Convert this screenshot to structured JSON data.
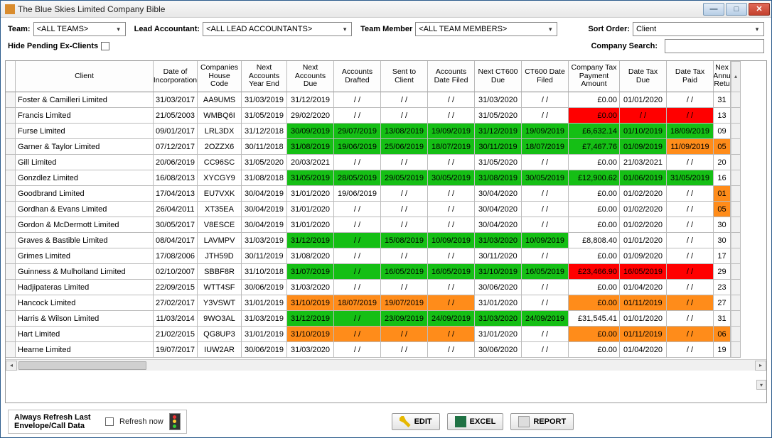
{
  "window": {
    "title": "The Blue Skies Limited Company Bible"
  },
  "filters": {
    "team_label": "Team:",
    "team_value": "<ALL TEAMS>",
    "lead_label": "Lead Accountant:",
    "lead_value": "<ALL LEAD ACCOUNTANTS>",
    "member_label": "Team Member",
    "member_value": "<ALL TEAM MEMBERS>",
    "sort_label": "Sort Order:",
    "sort_value": "Client",
    "hide_label": "Hide Pending Ex-Clients",
    "search_label": "Company Search:",
    "search_value": ""
  },
  "columns": [
    "Client",
    "Date of Incorporation",
    "Companies House Code",
    "Next Accounts Year End",
    "Next Accounts Due",
    "Accounts Drafted",
    "Sent to Client",
    "Accounts Date Filed",
    "Next CT600 Due",
    "CT600 Date Filed",
    "Company Tax Payment Amount",
    "Date Tax Due",
    "Date Tax Paid",
    "Nex Annu Retu"
  ],
  "rows": [
    {
      "c": [
        "Foster & Camilleri Limited",
        "31/03/2017",
        "AA9UMS",
        "31/03/2019",
        "31/12/2019",
        "/ /",
        "/ /",
        "/ /",
        "31/03/2020",
        "/ /",
        "£0.00",
        "01/01/2020",
        "/ /",
        "31"
      ],
      "bg": [
        "",
        "",
        "",
        "",
        "",
        "",
        "",
        "",
        "",
        "",
        "",
        "",
        "",
        ""
      ]
    },
    {
      "c": [
        "Francis Limited",
        "21/05/2003",
        "WMBQ6I",
        "31/05/2019",
        "29/02/2020",
        "/ /",
        "/ /",
        "/ /",
        "31/05/2020",
        "/ /",
        "£0.00",
        "/ /",
        "/ /",
        "13"
      ],
      "bg": [
        "",
        "",
        "",
        "",
        "",
        "",
        "",
        "",
        "",
        "",
        "red",
        "red",
        "red",
        ""
      ]
    },
    {
      "c": [
        "Furse Limited",
        "09/01/2017",
        "LRL3DX",
        "31/12/2018",
        "30/09/2019",
        "29/07/2019",
        "13/08/2019",
        "19/09/2019",
        "31/12/2019",
        "19/09/2019",
        "£6,632.14",
        "01/10/2019",
        "18/09/2019",
        "09"
      ],
      "bg": [
        "",
        "",
        "",
        "",
        "green",
        "green",
        "green",
        "green",
        "green",
        "green",
        "green",
        "green",
        "green",
        ""
      ]
    },
    {
      "c": [
        "Garner & Taylor Limited",
        "07/12/2017",
        "2OZZX6",
        "30/11/2018",
        "31/08/2019",
        "19/06/2019",
        "25/06/2019",
        "18/07/2019",
        "30/11/2019",
        "18/07/2019",
        "£7,467.76",
        "01/09/2019",
        "11/09/2019",
        "05"
      ],
      "bg": [
        "",
        "",
        "",
        "",
        "green",
        "green",
        "green",
        "green",
        "green",
        "green",
        "green",
        "green",
        "orange",
        "orange"
      ]
    },
    {
      "c": [
        "Gill Limited",
        "20/06/2019",
        "CC96SC",
        "31/05/2020",
        "20/03/2021",
        "/ /",
        "/ /",
        "/ /",
        "31/05/2020",
        "/ /",
        "£0.00",
        "21/03/2021",
        "/ /",
        "20"
      ],
      "bg": [
        "",
        "",
        "",
        "",
        "",
        "",
        "",
        "",
        "",
        "",
        "",
        "",
        "",
        ""
      ]
    },
    {
      "c": [
        "Gonzdlez Limited",
        "16/08/2013",
        "XYCGY9",
        "31/08/2018",
        "31/05/2019",
        "28/05/2019",
        "29/05/2019",
        "30/05/2019",
        "31/08/2019",
        "30/05/2019",
        "£12,900.62",
        "01/06/2019",
        "31/05/2019",
        "16"
      ],
      "bg": [
        "",
        "",
        "",
        "",
        "green",
        "green",
        "green",
        "green",
        "green",
        "green",
        "green",
        "green",
        "green",
        ""
      ]
    },
    {
      "c": [
        "Goodbrand Limited",
        "17/04/2013",
        "EU7VXK",
        "30/04/2019",
        "31/01/2020",
        "19/06/2019",
        "/ /",
        "/ /",
        "30/04/2020",
        "/ /",
        "£0.00",
        "01/02/2020",
        "/ /",
        "01"
      ],
      "bg": [
        "",
        "",
        "",
        "",
        "",
        "",
        "",
        "",
        "",
        "",
        "",
        "",
        "",
        "orange"
      ]
    },
    {
      "c": [
        "Gordhan & Evans Limited",
        "26/04/2011",
        "XT35EA",
        "30/04/2019",
        "31/01/2020",
        "/ /",
        "/ /",
        "/ /",
        "30/04/2020",
        "/ /",
        "£0.00",
        "01/02/2020",
        "/ /",
        "05"
      ],
      "bg": [
        "",
        "",
        "",
        "",
        "",
        "",
        "",
        "",
        "",
        "",
        "",
        "",
        "",
        "orange"
      ]
    },
    {
      "c": [
        "Gordon & McDermott Limited",
        "30/05/2017",
        "V8ESCE",
        "30/04/2019",
        "31/01/2020",
        "/ /",
        "/ /",
        "/ /",
        "30/04/2020",
        "/ /",
        "£0.00",
        "01/02/2020",
        "/ /",
        "30"
      ],
      "bg": [
        "",
        "",
        "",
        "",
        "",
        "",
        "",
        "",
        "",
        "",
        "",
        "",
        "",
        ""
      ]
    },
    {
      "c": [
        "Graves & Bastible Limited",
        "08/04/2017",
        "LAVMPV",
        "31/03/2019",
        "31/12/2019",
        "/ /",
        "15/08/2019",
        "10/09/2019",
        "31/03/2020",
        "10/09/2019",
        "£8,808.40",
        "01/01/2020",
        "/ /",
        "30"
      ],
      "bg": [
        "",
        "",
        "",
        "",
        "green",
        "green",
        "green",
        "green",
        "green",
        "green",
        "",
        "",
        "",
        ""
      ]
    },
    {
      "c": [
        "Grimes Limited",
        "17/08/2006",
        "JTH59D",
        "30/11/2019",
        "31/08/2020",
        "/ /",
        "/ /",
        "/ /",
        "30/11/2020",
        "/ /",
        "£0.00",
        "01/09/2020",
        "/ /",
        "17"
      ],
      "bg": [
        "",
        "",
        "",
        "",
        "",
        "",
        "",
        "",
        "",
        "",
        "",
        "",
        "",
        ""
      ]
    },
    {
      "c": [
        "Guinness & Mulholland Limited",
        "02/10/2007",
        "SBBF8R",
        "31/10/2018",
        "31/07/2019",
        "/ /",
        "16/05/2019",
        "16/05/2019",
        "31/10/2019",
        "16/05/2019",
        "£23,466.90",
        "16/05/2019",
        "/ /",
        "29"
      ],
      "bg": [
        "",
        "",
        "",
        "",
        "green",
        "green",
        "green",
        "green",
        "green",
        "green",
        "red",
        "red",
        "red",
        ""
      ]
    },
    {
      "c": [
        "Hadjipateras Limited",
        "22/09/2015",
        "WTT4SF",
        "30/06/2019",
        "31/03/2020",
        "/ /",
        "/ /",
        "/ /",
        "30/06/2020",
        "/ /",
        "£0.00",
        "01/04/2020",
        "/ /",
        "23"
      ],
      "bg": [
        "",
        "",
        "",
        "",
        "",
        "",
        "",
        "",
        "",
        "",
        "",
        "",
        "",
        ""
      ]
    },
    {
      "c": [
        "Hancock Limited",
        "27/02/2017",
        "Y3VSWT",
        "31/01/2019",
        "31/10/2019",
        "18/07/2019",
        "19/07/2019",
        "/ /",
        "31/01/2020",
        "/ /",
        "£0.00",
        "01/11/2019",
        "/ /",
        "27"
      ],
      "bg": [
        "",
        "",
        "",
        "",
        "orange",
        "orange",
        "orange",
        "orange",
        "",
        "",
        "orange",
        "orange",
        "orange",
        ""
      ]
    },
    {
      "c": [
        "Harris & Wilson Limited",
        "11/03/2014",
        "9WO3AL",
        "31/03/2019",
        "31/12/2019",
        "/ /",
        "23/09/2019",
        "24/09/2019",
        "31/03/2020",
        "24/09/2019",
        "£31,545.41",
        "01/01/2020",
        "/ /",
        "31"
      ],
      "bg": [
        "",
        "",
        "",
        "",
        "green",
        "green",
        "green",
        "green",
        "green",
        "green",
        "",
        "",
        "",
        ""
      ]
    },
    {
      "c": [
        "Hart Limited",
        "21/02/2015",
        "QG8UP3",
        "31/01/2019",
        "31/10/2019",
        "/ /",
        "/ /",
        "/ /",
        "31/01/2020",
        "/ /",
        "£0.00",
        "01/11/2019",
        "/ /",
        "06"
      ],
      "bg": [
        "",
        "",
        "",
        "",
        "orange",
        "orange",
        "orange",
        "orange",
        "",
        "",
        "orange",
        "orange",
        "orange",
        "orange"
      ]
    },
    {
      "c": [
        "Hearne Limited",
        "19/07/2017",
        "IUW2AR",
        "30/06/2019",
        "31/03/2020",
        "/ /",
        "/ /",
        "/ /",
        "30/06/2020",
        "/ /",
        "£0.00",
        "01/04/2020",
        "/ /",
        "19"
      ],
      "bg": [
        "",
        "",
        "",
        "",
        "",
        "",
        "",
        "",
        "",
        "",
        "",
        "",
        "",
        ""
      ]
    }
  ],
  "footer": {
    "always_refresh": "Always Refresh Last Envelope/Call Data",
    "refresh_now": "Refresh now",
    "edit": "EDIT",
    "excel": "EXCEL",
    "report": "REPORT"
  }
}
